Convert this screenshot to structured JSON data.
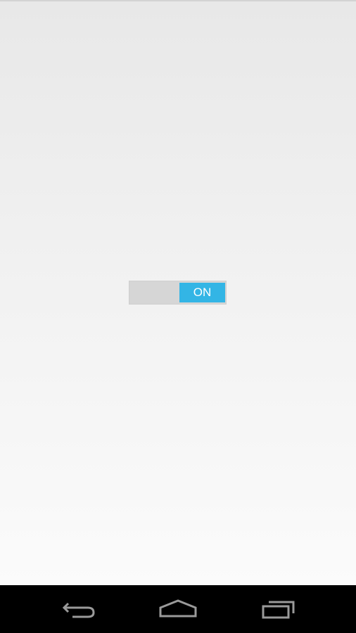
{
  "toggle": {
    "state_label": "ON",
    "checked": true,
    "accent_color": "#33b5e5"
  },
  "nav_bar": {
    "buttons": [
      {
        "icon": "back-icon"
      },
      {
        "icon": "home-icon"
      },
      {
        "icon": "recent-apps-icon"
      }
    ]
  },
  "colors": {
    "background_top": "#e8e8e8",
    "background_bottom": "#fbfbfb",
    "track": "#d6d6d6",
    "nav_bar": "#000000"
  }
}
